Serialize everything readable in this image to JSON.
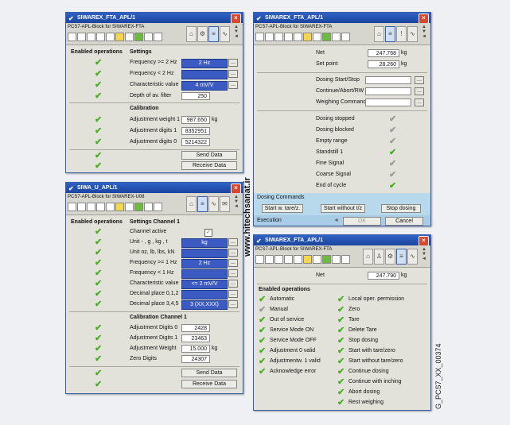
{
  "watermark": "www.hitechsanat.ir",
  "figure_id": "G_PCS7_XX_00374",
  "w1": {
    "title": "SIWAREX_FTA_APL/1",
    "tag": "PCS7-APL-Block for SIWAREX-FTA",
    "hdr_left": "Enabled operations",
    "hdr_right": "Settings",
    "settings": [
      {
        "label": "Frequency >= 2 Hz",
        "value": "2 Hz"
      },
      {
        "label": "Frequency < 2 Hz",
        "value": ""
      },
      {
        "label": "Characteristic value",
        "value": "4 mV/V"
      },
      {
        "label": "Depth of av. filter",
        "value": "250"
      }
    ],
    "calib_hdr": "Calibration",
    "calib": [
      {
        "label": "Adjustment weight 1",
        "value": "987.650",
        "unit": "kg"
      },
      {
        "label": "Adjustment digits 1",
        "value": "8352951",
        "unit": ""
      },
      {
        "label": "Adjustment digits 0",
        "value": "5214322",
        "unit": ""
      }
    ],
    "send": "Send Data",
    "receive": "Receive Data"
  },
  "w2": {
    "title": "SIWA_U_APL/1",
    "tag": "PCS7-APL-Block for SIWAREX-U08",
    "hdr_left": "Enabled operations",
    "hdr_right": "Settings Channel 1",
    "channel_active": "Channel active",
    "settings": [
      {
        "label": "Unit - , g , kg , t",
        "value": "kg"
      },
      {
        "label": "Unit oz, lb, lbs, kN",
        "value": ""
      },
      {
        "label": "Frequency >= 1 Hz",
        "value": "2 Hz"
      },
      {
        "label": "Frequency < 1 Hz",
        "value": ""
      },
      {
        "label": "Characteristic value",
        "value": "<= 2 mV/V"
      },
      {
        "label": "Decimal place 0,1,2",
        "value": ""
      },
      {
        "label": "Decimal place 3,4,5",
        "value": "3 (XX,XXX)"
      }
    ],
    "calib_hdr": "Calibration Channel 1",
    "calib": [
      {
        "label": "Adjustment Digits 0",
        "value": "2428",
        "unit": ""
      },
      {
        "label": "Adjustment Digits 1",
        "value": "23463",
        "unit": ""
      },
      {
        "label": "Adjustment Weight",
        "value": "15.000",
        "unit": "kg"
      },
      {
        "label": "Zero Digits",
        "value": "24307",
        "unit": ""
      }
    ],
    "send": "Send Data",
    "receive": "Receive Data"
  },
  "w3": {
    "title": "SIWAREX_FTA_APL/1",
    "tag": "PCS7-APL-Block for SIWAREX-FTA",
    "net_label": "Net",
    "net_value": "247.768",
    "net_unit": "kg",
    "sp_label": "Set point",
    "sp_value": "28.260",
    "sp_unit": "kg",
    "cmds": [
      "Dosing Start/Stop",
      "Continue/Abort/RW",
      "Weighing Command"
    ],
    "statuses": [
      {
        "label": "Dosing stopped",
        "state": "grey"
      },
      {
        "label": "Dosing blocked",
        "state": "grey"
      },
      {
        "label": "Empty range",
        "state": "grey"
      },
      {
        "label": "Standstill 1",
        "state": "green"
      },
      {
        "label": "Fine Signal",
        "state": "grey"
      },
      {
        "label": "Coarse Signal",
        "state": "grey"
      },
      {
        "label": "End of cycle",
        "state": "green"
      }
    ],
    "dosing_hdr": "Dosing Commands",
    "btn_tare": "Start w. tare/z.",
    "btn_notare": "Start without t/z",
    "btn_stop": "Stop dosing",
    "exec_label": "Execution",
    "ok": "OK",
    "cancel": "Cancel"
  },
  "w4": {
    "title": "SIWAREX_FTA_APL/1",
    "tag": "PCS7-APL-Block for SIWAREX-FTA",
    "net_label": "Net",
    "net_value": "247.790",
    "net_unit": "kg",
    "hdr": "Enabled operations",
    "left": [
      {
        "label": "Automatic",
        "state": "green"
      },
      {
        "label": "Manual",
        "state": "grey"
      },
      {
        "label": "Out of service",
        "state": "green"
      },
      {
        "label": "Service Mode ON",
        "state": "green"
      },
      {
        "label": "Service Mode OFF",
        "state": "green"
      },
      {
        "label": "Adjustment 0 valid",
        "state": "green"
      },
      {
        "label": "Adjustmentw. 1 valid",
        "state": "green"
      },
      {
        "label": "Acknowledge error",
        "state": "green"
      }
    ],
    "right": [
      {
        "label": "Local oper. permission",
        "state": "green"
      },
      {
        "label": "Zero",
        "state": "green"
      },
      {
        "label": "Tare",
        "state": "green"
      },
      {
        "label": "Delete Tare",
        "state": "green"
      },
      {
        "label": "Stop dosing",
        "state": "green"
      },
      {
        "label": "Start with tare/zero",
        "state": "green"
      },
      {
        "label": "Start without tare/zero",
        "state": "green"
      },
      {
        "label": "Continue dosing",
        "state": "green"
      },
      {
        "label": "Continue with inching",
        "state": "green"
      },
      {
        "label": "Abort dosing",
        "state": "green"
      },
      {
        "label": "Rest weighing",
        "state": "green"
      }
    ]
  }
}
